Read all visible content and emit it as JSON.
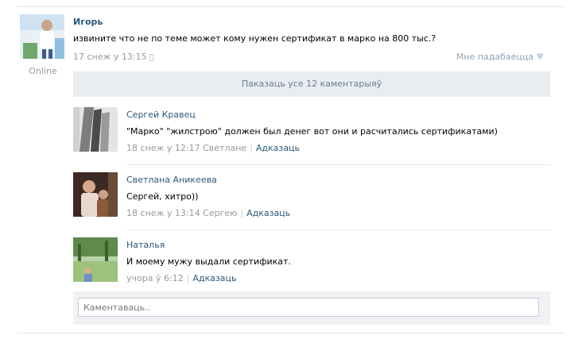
{
  "post": {
    "author": "Игорь",
    "online_label": "Online",
    "text": "извините что не по теме может кому нужен сертификат в марко на 800 тыс.?",
    "timestamp": "17 снеж у 13:15",
    "device_icon": "apple-icon",
    "like_label": "Мне падабаецца",
    "like_icon": "heart-icon"
  },
  "show_all_comments": "Паказаць усе 12 каментарыяў",
  "comments": [
    {
      "author": "Сергей Кравец",
      "text": "\"Марко\" \"жилстрою\" должен был денег вот они и расчитались сертификатами)",
      "timestamp": "18 снеж у 12:17 Светлане",
      "reply_label": "Адказаць"
    },
    {
      "author": "Светлана Аникеева",
      "text": "Сергей, хитро))",
      "timestamp": "18 снеж у 13:14 Сергею",
      "reply_label": "Адказаць"
    },
    {
      "author": "Наталья",
      "text": "И моему мужу выдали сертификат.",
      "timestamp": "учора ў 6:12",
      "reply_label": "Адказаць"
    }
  ],
  "composer": {
    "placeholder": "Каментаваць.."
  },
  "colors": {
    "link": "#2b587a",
    "meta": "#999999",
    "show_all_bg": "#e9edf1"
  }
}
